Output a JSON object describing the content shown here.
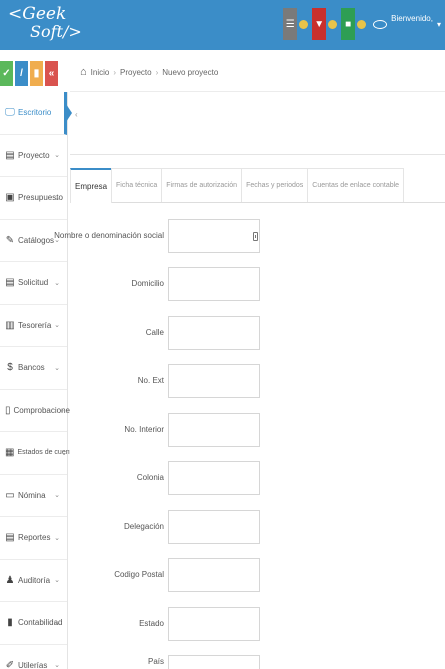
{
  "app": {
    "logo_line1": "<Geek",
    "logo_line2": "Soft/>"
  },
  "user": {
    "greeting": "Bienvenido,"
  },
  "breadcrumb": {
    "items": [
      "Inicio",
      "Proyecto",
      "Nuevo proyecto"
    ],
    "separator": "›"
  },
  "sidebar": {
    "items": [
      {
        "label": "Escritorio",
        "icon": "monitor-icon",
        "glyph": "🖵"
      },
      {
        "label": "Proyecto",
        "icon": "building-icon",
        "glyph": "▤"
      },
      {
        "label": "Presupuesto",
        "icon": "calculator-icon",
        "glyph": "▣"
      },
      {
        "label": "Catálogos",
        "icon": "edit-icon",
        "glyph": "✎"
      },
      {
        "label": "Solicitud",
        "icon": "list-icon",
        "glyph": "▤"
      },
      {
        "label": "Tesorería",
        "icon": "safe-icon",
        "glyph": "▥"
      },
      {
        "label": "Bancos",
        "icon": "dollar-icon",
        "glyph": "$"
      },
      {
        "label": "Comprobaciones",
        "icon": "file-icon",
        "glyph": "▯"
      },
      {
        "label": "Estados de cuentas",
        "icon": "table-icon",
        "glyph": "▦"
      },
      {
        "label": "Nómina",
        "icon": "card-icon",
        "glyph": "▭"
      },
      {
        "label": "Reportes",
        "icon": "report-icon",
        "glyph": "▤"
      },
      {
        "label": "Auditoría",
        "icon": "user-icon",
        "glyph": "♟"
      },
      {
        "label": "Contabilidad",
        "icon": "book-icon",
        "glyph": "▮"
      },
      {
        "label": "Utilerías",
        "icon": "wrench-icon",
        "glyph": "✐"
      }
    ]
  },
  "tabs": [
    {
      "label": "Empresa",
      "active": true
    },
    {
      "label": "Ficha técnica",
      "active": false
    },
    {
      "label": "Firmas de autorización",
      "active": false
    },
    {
      "label": "Fechas y periodos",
      "active": false
    },
    {
      "label": "Cuentas de enlace contable",
      "active": false
    }
  ],
  "form": {
    "fields": [
      {
        "label": "Nombre o denominación social",
        "value": ""
      },
      {
        "label": "Domicilio",
        "value": ""
      },
      {
        "label": "Calle",
        "value": ""
      },
      {
        "label": "No. Ext",
        "value": ""
      },
      {
        "label": "No. Interior",
        "value": ""
      },
      {
        "label": "Colonia",
        "value": ""
      },
      {
        "label": "Delegación",
        "value": ""
      },
      {
        "label": "Codigo Postal",
        "value": ""
      },
      {
        "label": "Estado",
        "value": ""
      },
      {
        "label": "País",
        "value": ""
      }
    ]
  },
  "colors": {
    "accent": "#3b8dc8",
    "green": "#5bb85b",
    "yellow": "#f0ad4e",
    "red": "#d9534f"
  }
}
